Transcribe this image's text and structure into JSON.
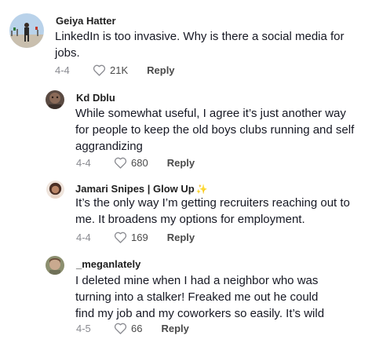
{
  "comments": [
    {
      "username": "Geiya Hatter",
      "text": "LinkedIn is too invasive. Why is there a social media for jobs.",
      "date": "4-4",
      "likes": "21K",
      "reply_label": "Reply"
    },
    {
      "username": "Kd Dblu",
      "text": "While somewhat useful, I agree it’s just another way for people to keep the old boys clubs running and self aggrandizing",
      "date": "4-4",
      "likes": "680",
      "reply_label": "Reply"
    },
    {
      "username": "Jamari  Snipes | Glow Up",
      "username_sparkle": "✨",
      "text": "It’s the only way I’m getting recruiters reaching out to me. It broadens my options for employment.",
      "date": "4-4",
      "likes": "169",
      "reply_label": "Reply"
    },
    {
      "username": "_meganlately",
      "text": "I deleted mine when I had a neighbor who was turning into a stalker! Freaked me out he could find my job and my coworkers so easily. It’s wild",
      "date": "4-5",
      "likes": "66",
      "reply_label": "Reply"
    }
  ],
  "icons": {
    "like": "heart-outline-icon"
  },
  "colors": {
    "text": "#161823",
    "meta": "#8a8b91",
    "sparkle": "#f2c94c"
  }
}
